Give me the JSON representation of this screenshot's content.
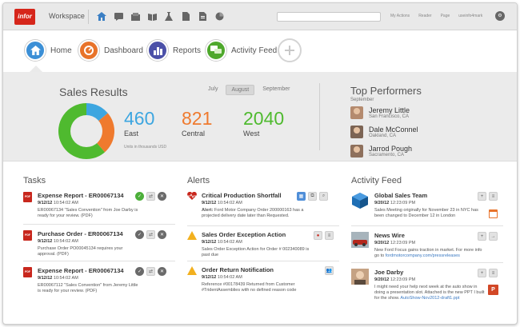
{
  "header": {
    "logo_text": "infor",
    "workspace_label": "Workspace",
    "icons": [
      "home-icon",
      "chat-icon",
      "inbox-icon",
      "book-icon",
      "flask-icon",
      "document-icon",
      "report-icon",
      "pie-chart-icon"
    ],
    "links": [
      "My Actions",
      "Reader",
      "Page",
      "useinfo4mark"
    ],
    "search_placeholder": ""
  },
  "nav": {
    "items": [
      {
        "label": "Home",
        "color": "#3b8fd6"
      },
      {
        "label": "Dashboard",
        "color": "#e8732a"
      },
      {
        "label": "Reports",
        "color": "#4b50a8"
      },
      {
        "label": "Activity Feed",
        "color": "#4ea82c"
      }
    ]
  },
  "sales": {
    "title": "Sales Results",
    "months": [
      "July",
      "August",
      "September"
    ],
    "selected_month": "August",
    "metrics": [
      {
        "value": "460",
        "label": "East",
        "color": "#3da6e0"
      },
      {
        "value": "821",
        "label": "Central",
        "color": "#ef7a2e"
      },
      {
        "value": "2040",
        "label": "West",
        "color": "#4fba2f"
      }
    ],
    "units": "Units in thousands USD",
    "donut": {
      "east": 460,
      "central": 821,
      "west": 2040
    }
  },
  "top_performers": {
    "title": "Top Performers",
    "month": "September",
    "people": [
      {
        "name": "Jeremy Little",
        "location": "San Francisco, CA"
      },
      {
        "name": "Dale McConnel",
        "location": "Oakland, CA"
      },
      {
        "name": "Jarrod Pough",
        "location": "Sacramento, CA"
      }
    ]
  },
  "tasks": {
    "title": "Tasks",
    "items": [
      {
        "title": "Expense Report - ER00067134",
        "date": "9/12/12",
        "time": "10:54:02 AM",
        "desc": "ER00067134 \"Sales Convention\" from Joe Darby is ready for your review. (PDF)"
      },
      {
        "title": "Purchase Order - ER00067134",
        "date": "9/12/12",
        "time": "10:54:02 AM",
        "desc": "Purchase Order PO00045134 requires your approval. (PDF)"
      },
      {
        "title": "Expense Report - ER00067134",
        "date": "9/12/12",
        "time": "10:54:02 AM",
        "desc": "ER00067112 \"Sales Convention\" from Jeremy Little is ready for your review. (PDF)"
      }
    ]
  },
  "alerts": {
    "title": "Alerts",
    "items": [
      {
        "title": "Critical Production Shortfall",
        "date": "9/12/12",
        "time": "10:54:02 AM",
        "desc_bold": "Alert:",
        "desc": " Ford Motor Company Order 200000163 has a projected delivery date later than Requested."
      },
      {
        "title": "Sales Order Exception Action",
        "date": "9/12/12",
        "time": "10:54:02 AM",
        "desc": "Sales Order Exception Action for Order # 002340089 is past due"
      },
      {
        "title": "Order Return Notification",
        "date": "9/12/12",
        "time": "10:54:02 AM",
        "desc": "Reference #00178439 Returned from Customer #TridentAssemblies with no defined reason code"
      }
    ]
  },
  "feed": {
    "title": "Activity Feed",
    "items": [
      {
        "title": "Global Sales Team",
        "date": "9/20/12",
        "time": "12:23:09 PM",
        "desc": "Sales Meeting originally for November 23 in NYC has been changed to December 12 in London"
      },
      {
        "title": "News Wire",
        "date": "9/20/12",
        "time": "12:23:09 PM",
        "desc": "New Ford Focus gains traction in market. For more info go to ",
        "link": "fordmotorcompany.com/pressreleases"
      },
      {
        "title": "Joe Darby",
        "date": "9/20/12",
        "time": "12:23:09 PM",
        "desc": "I might need your help next week at the auto show in doing a presentation slot. Attached is the new PPT I built for the show. ",
        "link": "AutoShow-Nov2012-draft1.ppt"
      }
    ]
  }
}
